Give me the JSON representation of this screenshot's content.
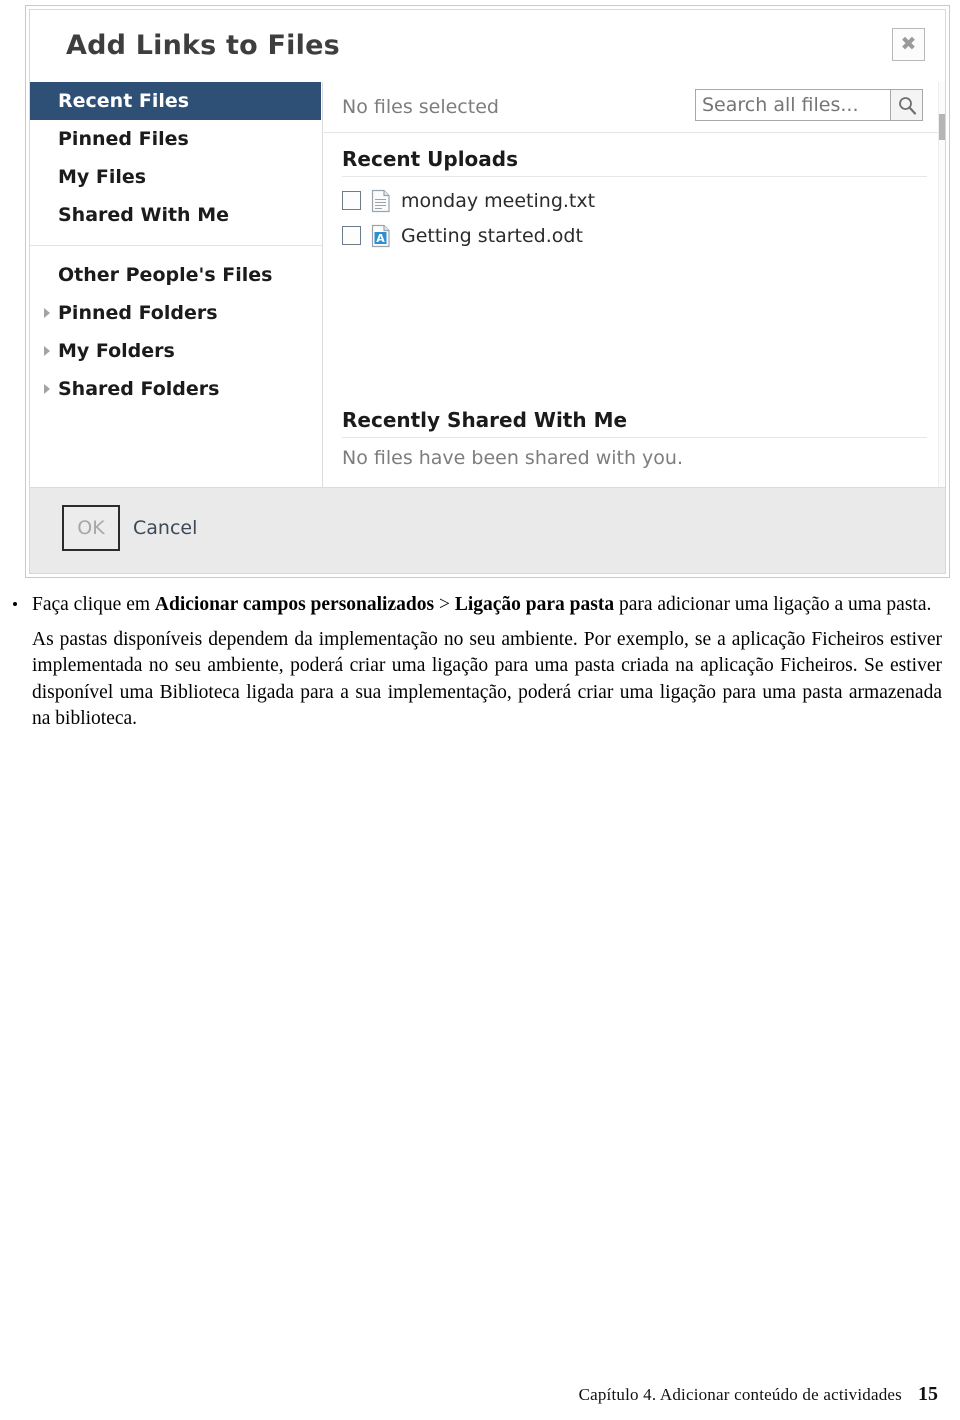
{
  "dialog": {
    "title": "Add Links to Files",
    "close_icon": "close-icon",
    "sidebar": {
      "groups": [
        {
          "items": [
            {
              "label": "Recent Files",
              "selected": true,
              "expandable": false
            },
            {
              "label": "Pinned Files",
              "selected": false,
              "expandable": false
            },
            {
              "label": "My Files",
              "selected": false,
              "expandable": false
            },
            {
              "label": "Shared With Me",
              "selected": false,
              "expandable": false
            }
          ]
        },
        {
          "items": [
            {
              "label": "Other People's Files",
              "selected": false,
              "expandable": false
            },
            {
              "label": "Pinned Folders",
              "selected": false,
              "expandable": true
            },
            {
              "label": "My Folders",
              "selected": false,
              "expandable": true
            },
            {
              "label": "Shared Folders",
              "selected": false,
              "expandable": true
            }
          ]
        }
      ]
    },
    "content": {
      "selection_status": "No files selected",
      "search": {
        "value": "",
        "placeholder": "Search all files...",
        "button_icon": "search-icon"
      },
      "recent_uploads": {
        "title": "Recent Uploads",
        "files": [
          {
            "name": "monday meeting.txt",
            "icon": "text-file-icon",
            "checked": false
          },
          {
            "name": "Getting started.odt",
            "icon": "odt-file-icon",
            "checked": false
          }
        ]
      },
      "recently_shared": {
        "title": "Recently Shared With Me",
        "empty_message": "No files have been shared with you."
      }
    },
    "footer": {
      "ok_label": "OK",
      "cancel_label": "Cancel"
    },
    "colors": {
      "selected_nav_bg": "#2e5076",
      "footer_bg": "#eaeaea",
      "odt_badge": "#2e8fd0"
    }
  },
  "document": {
    "bullet": {
      "line1_pre": "Faça clique em ",
      "line1_bold1": "Adicionar campos personalizados",
      "line1_mid": " > ",
      "line1_bold2": "Ligação para pasta",
      "line1_post": " para adicionar uma ligação a uma pasta."
    },
    "paragraph": "As pastas disponíveis dependem da implementação no seu ambiente. Por exemplo, se a aplicação Ficheiros estiver implementada no seu ambiente, poderá criar uma ligação para uma pasta criada na aplicação Ficheiros. Se estiver disponível uma Biblioteca ligada para a sua implementação, poderá criar uma ligação para uma pasta armazenada na biblioteca."
  },
  "page_footer": {
    "chapter": "Capítulo 4. Adicionar conteúdo de actividades",
    "page_number": "15"
  }
}
